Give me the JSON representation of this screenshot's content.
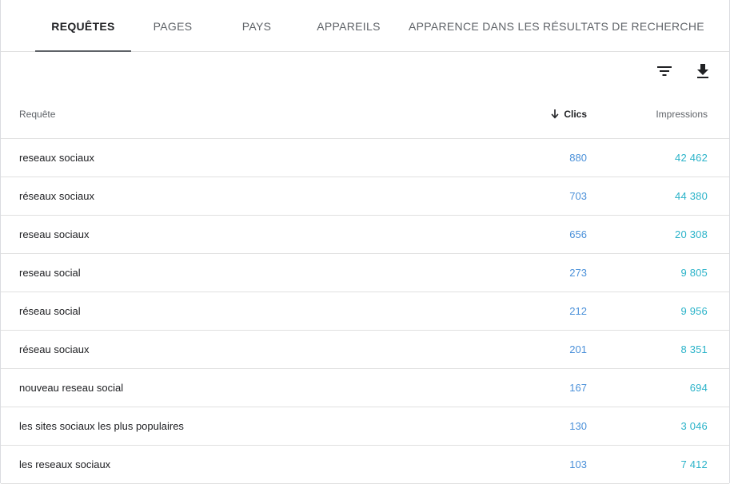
{
  "tabs": [
    {
      "label": "REQUÊTES",
      "active": true
    },
    {
      "label": "PAGES",
      "active": false
    },
    {
      "label": "PAYS",
      "active": false
    },
    {
      "label": "APPAREILS",
      "active": false
    },
    {
      "label": "APPARENCE DANS LES RÉSULTATS DE RECHERCHE",
      "active": false
    }
  ],
  "toolbar": {
    "filter_icon": "filter-icon",
    "download_icon": "download-icon"
  },
  "table": {
    "columns": {
      "query": "Requête",
      "clicks": "Clics",
      "impressions": "Impressions"
    },
    "sort_icon": "arrow-down-icon",
    "rows": [
      {
        "query": "reseaux sociaux",
        "clicks": "880",
        "impressions": "42 462"
      },
      {
        "query": "réseaux sociaux",
        "clicks": "703",
        "impressions": "44 380"
      },
      {
        "query": "reseau sociaux",
        "clicks": "656",
        "impressions": "20 308"
      },
      {
        "query": "reseau social",
        "clicks": "273",
        "impressions": "9 805"
      },
      {
        "query": "réseau social",
        "clicks": "212",
        "impressions": "9 956"
      },
      {
        "query": "réseau sociaux",
        "clicks": "201",
        "impressions": "8 351"
      },
      {
        "query": "nouveau reseau social",
        "clicks": "167",
        "impressions": "694"
      },
      {
        "query": "les sites sociaux les plus populaires",
        "clicks": "130",
        "impressions": "3 046"
      },
      {
        "query": "les reseaux sociaux",
        "clicks": "103",
        "impressions": "7 412"
      }
    ]
  },
  "colors": {
    "clicks": "#4a90d9",
    "impressions": "#2bb3c9",
    "active_tab_indicator": "#5f6368"
  }
}
